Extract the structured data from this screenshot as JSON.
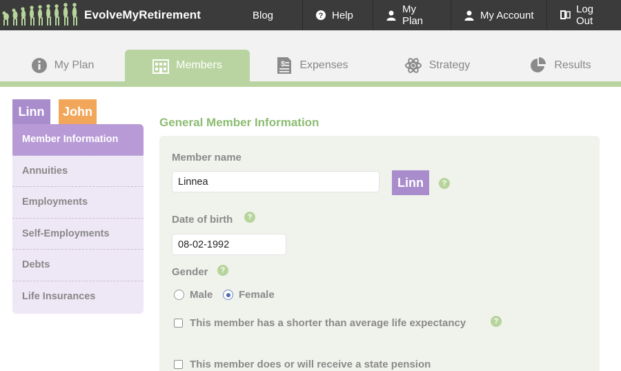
{
  "brand": {
    "name": "EvolveMyRetirement",
    "logo_icon": "evolution-silhouettes-logo"
  },
  "topnav": [
    {
      "label": "Blog",
      "icon": ""
    },
    {
      "label": "Help",
      "icon": "question-circle-icon"
    },
    {
      "label": "My Plan",
      "icon": "person-icon"
    },
    {
      "label": "My Account",
      "icon": "person-icon"
    },
    {
      "label": "Log Out",
      "icon": "logout-door-icon"
    }
  ],
  "tabs": [
    {
      "label": "My Plan",
      "icon": "info-icon"
    },
    {
      "label": "Members",
      "icon": "building-icon",
      "active": true
    },
    {
      "label": "Expenses",
      "icon": "invoice-icon"
    },
    {
      "label": "Strategy",
      "icon": "atom-icon"
    },
    {
      "label": "Results",
      "icon": "pie-chart-icon"
    }
  ],
  "members": [
    {
      "short": "Linn",
      "color": "#a98ccc",
      "active": true
    },
    {
      "short": "John",
      "color": "#f2a65a"
    }
  ],
  "sidebar": {
    "items": [
      {
        "label": "Member Information",
        "active": true
      },
      {
        "label": "Annuities"
      },
      {
        "label": "Employments"
      },
      {
        "label": "Self-Employments"
      },
      {
        "label": "Debts"
      },
      {
        "label": "Life Insurances"
      }
    ]
  },
  "main": {
    "section_title": "General Member Information",
    "member_name_label": "Member name",
    "member_name_value": "Linnea",
    "member_badge": "Linn",
    "dob_label": "Date of birth",
    "dob_value": "08-02-1992",
    "gender_label": "Gender",
    "gender_options": [
      "Male",
      "Female"
    ],
    "gender_selected": "Female",
    "shorter_life_label": "This member has a shorter than average life expectancy",
    "state_pension_label": "This member does or will receive a state pension"
  },
  "colors": {
    "topbar": "#3b3b3b",
    "tab_active": "#b9d4a0",
    "accent_green": "#8cbc72",
    "member_linn": "#a98ccc",
    "member_john": "#f2a65a",
    "sidebar_bg": "#eee7f5",
    "sidebar_active": "#b79ad6",
    "panel_bg": "#f0f2ec"
  }
}
